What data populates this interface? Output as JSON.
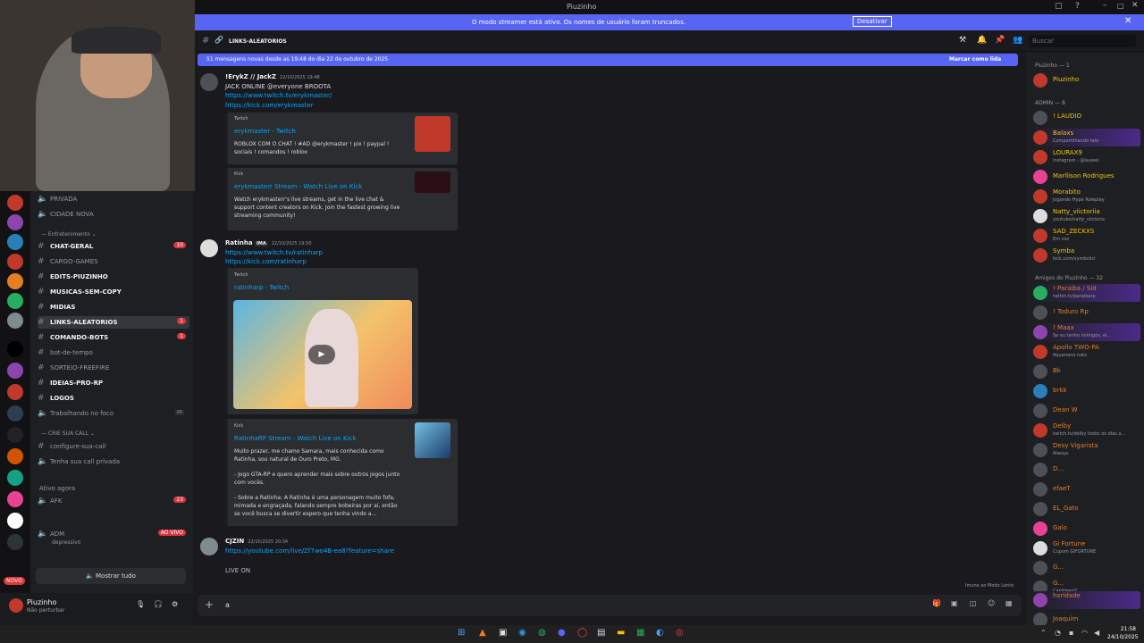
{
  "window": {
    "title": "Piuzinho"
  },
  "banner": {
    "message": "O modo streamer está ativo. Os nomes de usuário foram truncados.",
    "button": "Desativar"
  },
  "channel_header": {
    "name": "LINKS-ALEATORIOS",
    "search_placeholder": "Buscar"
  },
  "new_messages": {
    "text": "51 mensagens novas desde as 19:48 do dia 22 de outubro de 2025",
    "action": "Marcar como lida"
  },
  "channels": {
    "top": [
      {
        "label": "PRIVADA"
      },
      {
        "label": "CIDADE NOVA"
      }
    ],
    "category_ent": "Entretenimento",
    "items": [
      {
        "label": "CHAT-GERAL",
        "bold": true,
        "badge": "10"
      },
      {
        "label": "CARGO-GAMES",
        "bold": false,
        "badge": ""
      },
      {
        "label": "EDITS-PIUZINHO",
        "bold": true,
        "badge": ""
      },
      {
        "label": "MUSICAS-SEM-COPY",
        "bold": true,
        "badge": ""
      },
      {
        "label": "MIDIAS",
        "bold": true,
        "badge": ""
      },
      {
        "label": "LINKS-ALEATORIOS",
        "bold": true,
        "badge": "1"
      },
      {
        "label": "COMANDO-BOTS",
        "bold": true,
        "badge": "1"
      },
      {
        "label": "bot-de-tempo",
        "bold": false,
        "badge": ""
      },
      {
        "label": "SORTEIO-FREEFIRE",
        "bold": false,
        "badge": ""
      },
      {
        "label": "IDEIAS-PRO-RP",
        "bold": true,
        "badge": ""
      },
      {
        "label": "LOGOS",
        "bold": true,
        "badge": ""
      },
      {
        "label": "Trabalhando no foco",
        "bold": false,
        "badge": ""
      }
    ],
    "focus_counts": [
      "00",
      "33"
    ],
    "category_call": "CRIE SUA CALL",
    "call_items": [
      {
        "label": "configure-sua-call"
      },
      {
        "label": "Tenha sua call privada"
      }
    ],
    "active_now": "Ativo agora",
    "afk": "AFK",
    "afk_count": "23",
    "adm": "ADM",
    "adm_status": "depressivo",
    "live": "AO VIVO",
    "show_all": "Mostrar tudo"
  },
  "servers": {
    "new_badge": "NOVO"
  },
  "user": {
    "name": "Piuzinho",
    "status": "Não perturbar"
  },
  "messages": [
    {
      "author": "!ErykZ // JackZ",
      "time": "22/10/2025 19:48",
      "lines": [
        "JACK ONLINE  @everyone  BROOTA"
      ],
      "links": [
        "https://www.twitch.tv/erykmaster/",
        "https://kick.com/erykmaster"
      ],
      "embeds": [
        {
          "provider": "Twitch",
          "title": "erykmaster - Twitch",
          "desc": "ROBLOX COM O CHAT ! #AD @erykmaster ! pix ! paypal ! sociais ! comandos ! roblox"
        },
        {
          "provider": "Kick",
          "title": "erykmasterr Stream - Watch Live on Kick",
          "desc": "Watch erykmasterr's live streams, get in the live chat & support content creators on Kick. Join the fastest growing live streaming community!"
        }
      ]
    },
    {
      "author": "Ratinha",
      "tag": "IMA",
      "time": "22/10/2025 19:50",
      "links": [
        "https://www.twitch.tv/ratinharp",
        "https://kick.com/ratinharp"
      ],
      "embeds": [
        {
          "provider": "Twitch",
          "title": "ratinharp - Twitch"
        },
        {
          "provider": "Kick",
          "title": "RatinhaRP Stream - Watch Live on Kick",
          "desc": "Muito prazer, me chamo Samara, mais conhecida como Ratinha, sou natural de Ouro Preto, MG.",
          "desc2": "- Jogo GTA-RP e quero aprender mais sobre outros jogos junto com vocês.",
          "desc3": "- Sobre a Ratinha: A Ratinha é uma personagem muito fofa, mimada e engraçada, falando sempre bobeiras por aí, então se você busca se divertir espero que tenha vindo a..."
        }
      ]
    },
    {
      "author": "CJZIN",
      "time": "22/10/2025 20:34",
      "links": [
        "https://youtube.com/live/Zf7wo4B-ea8?feature=share"
      ],
      "lines": [
        "LIVE ON"
      ]
    }
  ],
  "composer": {
    "value": "a"
  },
  "footer_hint": "Imune ao Modo Lento",
  "members": {
    "cat1": "Piuzinho — 1",
    "cat2": "ADMIN — 8",
    "cat3": "Amigos do Piuzinho — 32",
    "owner": {
      "name": "Piuzinho"
    },
    "admins": [
      {
        "name": "! LAUDIO",
        "status": ""
      },
      {
        "name": "Balaxs",
        "status": "Compartilhando tela"
      },
      {
        "name": "LOURAX9",
        "status": "Instagram - @lauwel"
      },
      {
        "name": "Marllison Rodrigues",
        "status": ""
      },
      {
        "name": "Morabito",
        "status": "Jogando Hype Roleplay"
      },
      {
        "name": "Natty_viictoriia",
        "status": "youtube/natty_viictoria"
      },
      {
        "name": "SAD_ZECKXS",
        "status": "Em voz"
      },
      {
        "name": "Symba",
        "status": "kick.com/symbolici"
      }
    ],
    "friends": [
      {
        "name": "! Paraiba / Sid",
        "status": "twitch.tv/paraibarp",
        "tag": "EZ"
      },
      {
        "name": "! Toduro Rp",
        "status": "",
        "tag": ""
      },
      {
        "name": "! Maax",
        "status": "Se eu tenho inimigos, el...",
        "tag": ""
      },
      {
        "name": "Apollo TWO-PA",
        "status": "Aquariano nato",
        "tag": ""
      },
      {
        "name": "Bk",
        "status": "",
        "tag": ""
      },
      {
        "name": "brkk",
        "status": "",
        "tag": "Bexx"
      },
      {
        "name": "Dean W",
        "status": "",
        "tag": ""
      },
      {
        "name": "Delby",
        "status": "twitch.tv/delby todos os dias a...",
        "tag": ""
      },
      {
        "name": "Desy Vigarista",
        "status": "Always",
        "tag": "HYPE"
      },
      {
        "name": "D...",
        "status": "",
        "tag": ""
      },
      {
        "name": "efaeT",
        "status": "",
        "tag": ""
      },
      {
        "name": "EL_Gato",
        "status": "",
        "tag": ""
      },
      {
        "name": "Galo",
        "status": "",
        "tag": "SALV"
      },
      {
        "name": "Gi Fortune",
        "status": "Cupom GIFORTUNE",
        "tag": ""
      },
      {
        "name": "G...",
        "status": "",
        "tag": "ONIS"
      },
      {
        "name": "G...",
        "status": "Capitãwol?",
        "tag": "CDA"
      },
      {
        "name": "hxridxde",
        "status": "",
        "tag": ""
      },
      {
        "name": "Joaquim",
        "status": "",
        "tag": "JKGZ"
      }
    ]
  },
  "clock": {
    "time": "21:58",
    "date": "24/10/2025"
  }
}
